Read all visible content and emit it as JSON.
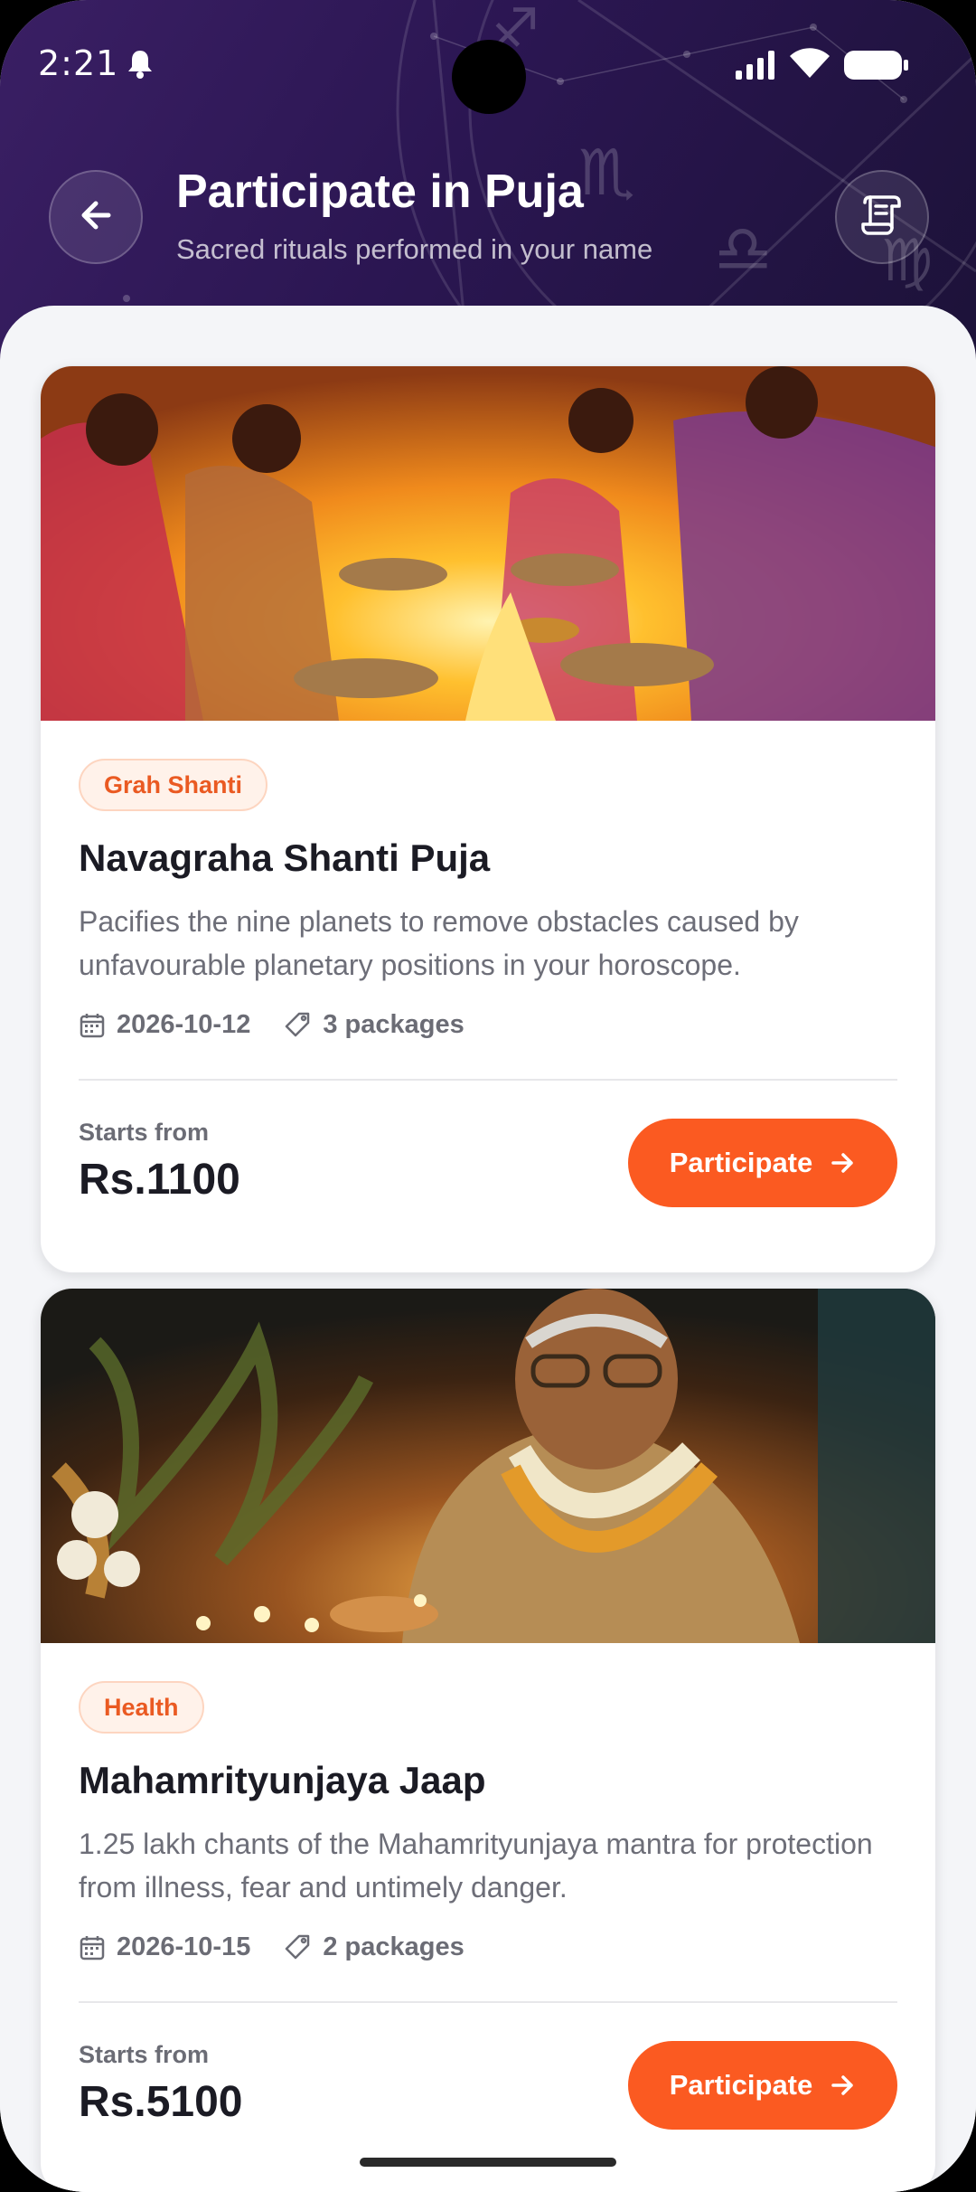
{
  "status": {
    "time": "2:21"
  },
  "header": {
    "title": "Participate in Puja",
    "subtitle": "Sacred rituals performed in your name",
    "back_icon": "arrow-left-icon",
    "action_icon": "receipt-scroll-icon"
  },
  "pujas": [
    {
      "tag": "Grah Shanti",
      "title": "Navagraha Shanti Puja",
      "description": "Pacifies the nine planets to remove obstacles caused by unfavourable planetary positions in your horoscope.",
      "date": "2026-10-12",
      "packages": "3 packages",
      "starts_label": "Starts from",
      "price": "Rs.1100",
      "cta": "Participate"
    },
    {
      "tag": "Health",
      "title": "Mahamrityunjaya Jaap",
      "description": "1.25 lakh chants of the Mahamrityunjaya mantra for protection from illness, fear and untimely danger.",
      "date": "2026-10-15",
      "packages": "2 packages",
      "starts_label": "Starts from",
      "price": "Rs.5100",
      "cta": "Participate"
    }
  ],
  "colors": {
    "accent": "#fb5a21",
    "header_bg": "#2b1652",
    "tag_text": "#ea5a22"
  }
}
